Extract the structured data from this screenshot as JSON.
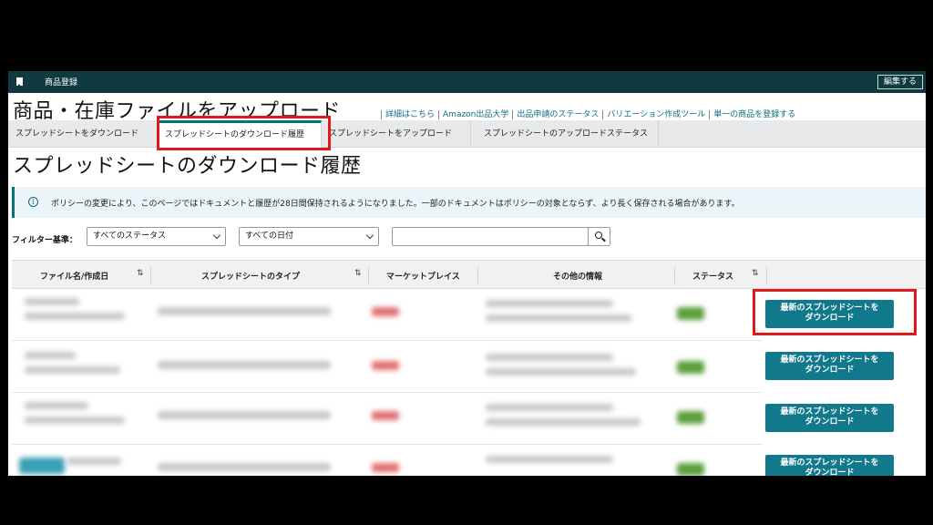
{
  "topbar": {
    "title": "商品登録",
    "edit_label": "編集する"
  },
  "page_title": "商品・在庫ファイルをアップロード",
  "header_links": [
    "詳細はこちら",
    "Amazon出品大学",
    "出品申請のステータス",
    "バリエーション作成ツール",
    "単一の商品を登録する"
  ],
  "tabs": [
    {
      "label": "スプレッドシートをダウンロード"
    },
    {
      "label": "スプレッドシートのダウンロード履歴",
      "active": true
    },
    {
      "label": "スプレッドシートをアップロード"
    },
    {
      "label": "スプレッドシートのアップロードステータス"
    }
  ],
  "section_title": "スプレッドシートのダウンロード履歴",
  "info_message": "ポリシーの変更により、このページではドキュメントと履歴が28日間保持されるようになりました。一部のドキュメントはポリシーの対象とならず、より長く保存される場合があります。",
  "filter": {
    "label": "フィルター基準：",
    "status_value": "すべてのステータス",
    "date_value": "すべての日付",
    "search_value": ""
  },
  "table": {
    "columns": [
      "ファイル名/作成日",
      "スプレッドシートのタイプ",
      "マーケットプレイス",
      "その他の情報",
      "ステータス"
    ],
    "download_button_label": "最新のスプレッドシートを\nダウンロード",
    "row_count_visible": 4
  },
  "colors": {
    "topbar": "#0f3b40",
    "accent": "#0a6d80",
    "button": "#12788c",
    "highlight": "#e0181e",
    "info_bg": "#eaf4f9"
  }
}
